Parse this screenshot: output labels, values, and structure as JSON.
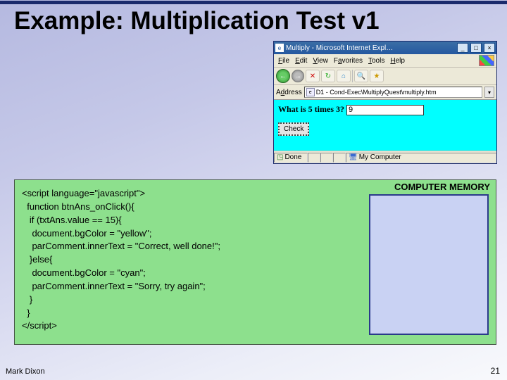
{
  "slide": {
    "title": "Example: Multiplication Test v1",
    "author": "Mark Dixon",
    "page_number": "21"
  },
  "browser": {
    "window_title": "Multiply - Microsoft Internet Expl…",
    "min_label": "_",
    "max_label": "□",
    "close_label": "×",
    "menu": {
      "file": "File",
      "edit": "Edit",
      "view": "View",
      "favorites": "Favorites",
      "tools": "Tools",
      "help": "Help"
    },
    "toolbar": {
      "back": "←",
      "forward": "→",
      "stop": "✕",
      "refresh": "↻",
      "home": "⌂",
      "search": "🔍",
      "favorites": "★"
    },
    "address": {
      "label": "Address",
      "value": "D1 - Cond-Exec\\MultiplyQuest\\multiply.htm",
      "dropdown": "▾"
    },
    "page": {
      "question": "What is 5 times 3?",
      "answer_value": "9",
      "check_button": "Check"
    },
    "status": {
      "done": "Done",
      "my_computer": "My Computer"
    }
  },
  "code": {
    "memory_label": "COMPUTER MEMORY",
    "lines": [
      "<script language=\"javascript\">",
      "  function btnAns_onClick(){",
      "   if (txtAns.value == 15){",
      "    document.bgColor = \"yellow\";",
      "    parComment.innerText = \"Correct, well done!\";",
      "   }else{",
      "    document.bgColor = \"cyan\";",
      "    parComment.innerText = \"Sorry, try again\";",
      "   }",
      "  }",
      "</script>"
    ]
  }
}
